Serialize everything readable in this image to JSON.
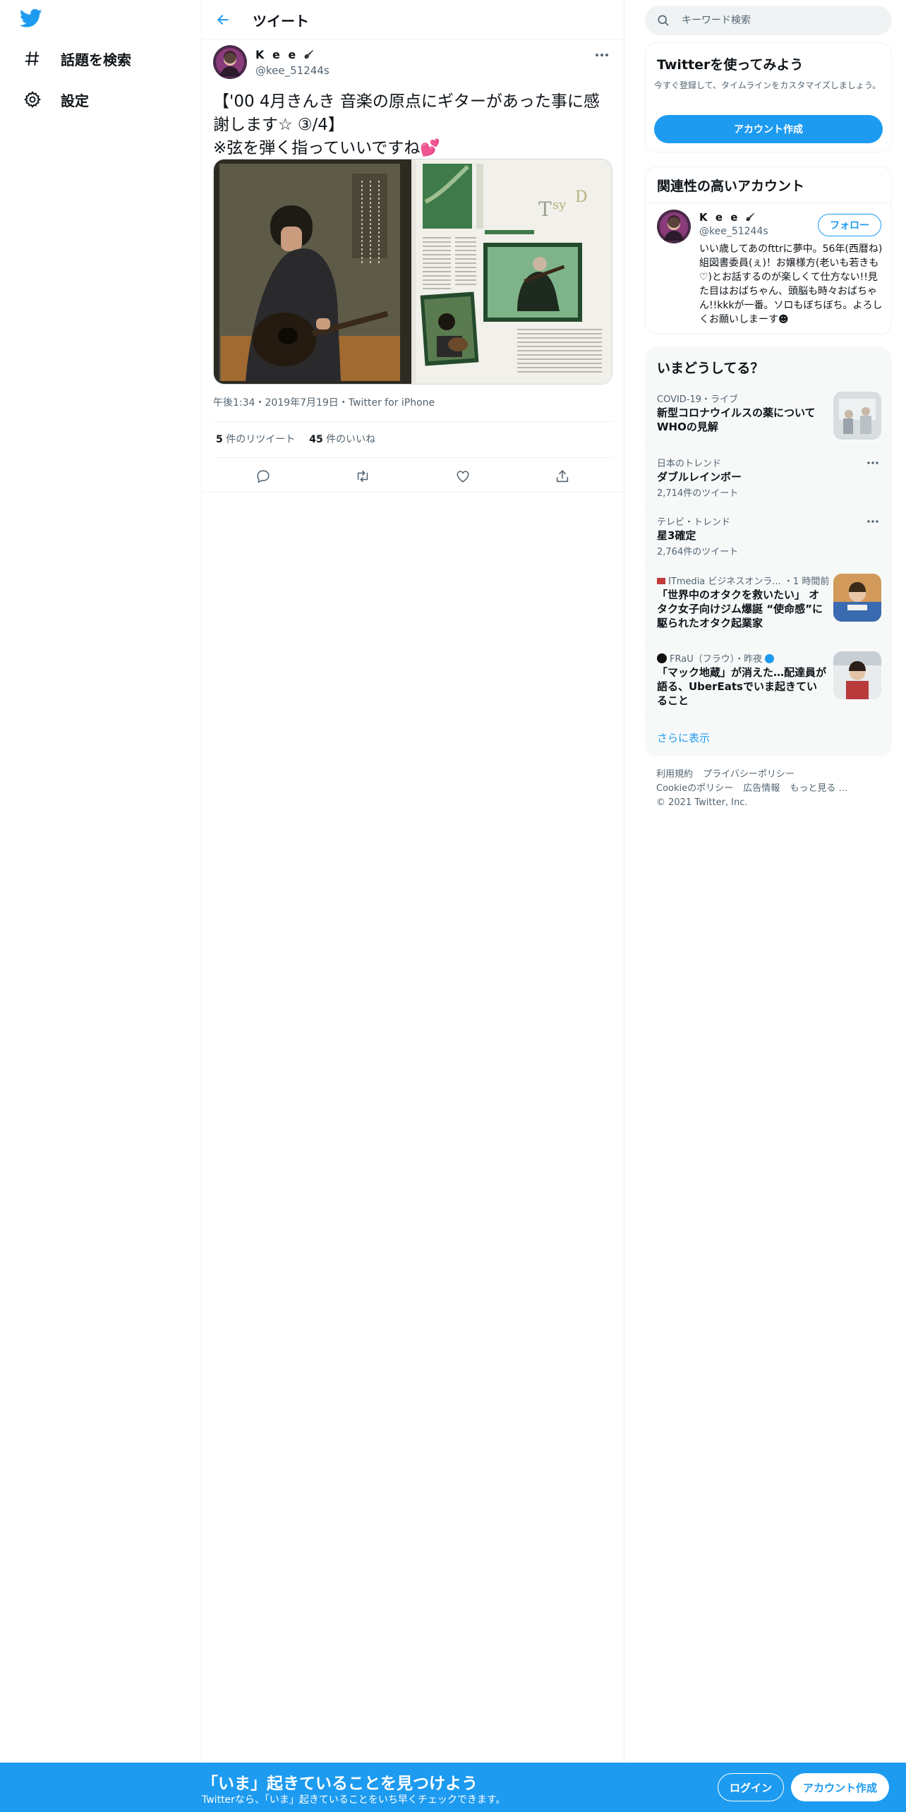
{
  "colors": {
    "brand": "#1d9bf0",
    "text": "#0f1419",
    "muted": "#536471",
    "like_accent": "#e0245e"
  },
  "left_nav": {
    "logo_icon": "twitter-bird-icon",
    "items": [
      {
        "label": "話題を検索",
        "icon": "hashtag-icon"
      },
      {
        "label": "設定",
        "icon": "gear-icon"
      }
    ]
  },
  "header": {
    "title": "ツイート",
    "back_icon": "arrow-left-icon"
  },
  "tweet": {
    "author_name": "K e e",
    "author_handle": "@kee_51244s",
    "text_line1": "【'00 4月きんき 音楽の原点にギターがあった事に感謝します☆ ③/4】",
    "text_line2": "※弦を弾く指っていいですね💕",
    "media_alt": "magazine scan of guitarist",
    "timestamp": "午後1:34・2019年7月19日・Twitter for iPhone",
    "retweets_count": "5",
    "retweets_label": "件のリツイート",
    "likes_count": "45",
    "likes_label": "件のいいね"
  },
  "search": {
    "placeholder": "キーワード検索"
  },
  "signup_card": {
    "title": "Twitterを使ってみよう",
    "description": "今すぐ登録して、タイムラインをカスタマイズしましょう。",
    "button": "アカウント作成"
  },
  "related": {
    "title": "関連性の高いアカウント",
    "name": "K e e",
    "handle": "@kee_51244s",
    "follow_label": "フォロー",
    "bio": "いい歳してあのfttrに夢中。56年(西暦ね)組図書委員(ぇ)！お嬢様方(老いも若きも♡)とお話するのが楽しくて仕方ない!!見た目はおばちゃん、頭脳も時々おばちゃん!!kkkが一番。ソロもぼちぼち。よろしくお願いしまーす☻"
  },
  "trends": {
    "title": "いまどうしてる？",
    "items": [
      {
        "meta": "COVID-19・ライブ",
        "title": "新型コロナウイルスの薬についてWHOの見解",
        "count": ""
      },
      {
        "meta": "日本のトレンド",
        "title": "ダブルレインボー",
        "count": "2,714件のツイート"
      },
      {
        "meta": "テレビ・トレンド",
        "title": "星3確定",
        "count": "2,764件のツイート"
      },
      {
        "meta": "ITmedia ビジネスオンラ... ・1 時間前",
        "title": "「世界中のオタクを救いたい」 オタク女子向けジム爆誕 “使命感”に駆られたオタク起業家",
        "count": ""
      },
      {
        "meta": "FRaU（フラウ）・昨夜",
        "title": "「マック地蔵」が消えた…配達員が語る、UberEatsでいま起きていること",
        "count": ""
      }
    ],
    "show_more": "さらに表示"
  },
  "footer": {
    "links": [
      "利用規約",
      "プライバシーポリシー",
      "Cookieのポリシー",
      "広告情報",
      "もっと見る …"
    ],
    "copyright": "© 2021 Twitter, Inc."
  },
  "bottom_bar": {
    "title": "「いま」起きていることを見つけよう",
    "subtitle": "Twitterなら、「いま」起きていることをいち早くチェックできます。",
    "login": "ログイン",
    "signup": "アカウント作成"
  }
}
